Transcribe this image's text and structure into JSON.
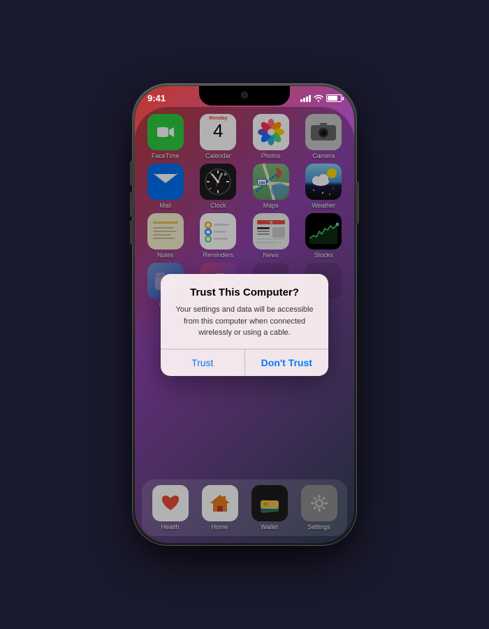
{
  "phone": {
    "time": "9:41",
    "notch": true
  },
  "apps": {
    "row1": [
      {
        "id": "facetime",
        "label": "FaceTime",
        "type": "facetime"
      },
      {
        "id": "calendar",
        "label": "Calendar",
        "type": "calendar",
        "day": "4",
        "dayName": "Monday"
      },
      {
        "id": "photos",
        "label": "Photos",
        "type": "photos"
      },
      {
        "id": "camera",
        "label": "Camera",
        "type": "camera"
      }
    ],
    "row2": [
      {
        "id": "mail",
        "label": "Mail",
        "type": "mail"
      },
      {
        "id": "clock",
        "label": "Clock",
        "type": "clock"
      },
      {
        "id": "maps",
        "label": "Maps",
        "type": "maps"
      },
      {
        "id": "weather",
        "label": "Weather",
        "type": "weather"
      }
    ],
    "row3": [
      {
        "id": "notes",
        "label": "Notes",
        "type": "notes"
      },
      {
        "id": "reminders",
        "label": "Reminders",
        "type": "reminders"
      },
      {
        "id": "news",
        "label": "News",
        "type": "news"
      },
      {
        "id": "stocks",
        "label": "Stocks",
        "type": "stocks"
      }
    ],
    "row4": [
      {
        "id": "files",
        "label": "Files",
        "type": "files"
      },
      {
        "id": "music",
        "label": "Music",
        "type": "music"
      },
      {
        "id": "empty1",
        "label": "",
        "type": "empty"
      },
      {
        "id": "empty2",
        "label": "",
        "type": "empty"
      }
    ],
    "dock": [
      {
        "id": "health",
        "label": "Health",
        "type": "health"
      },
      {
        "id": "home-app",
        "label": "Home",
        "type": "home-app"
      },
      {
        "id": "wallet",
        "label": "Wallet",
        "type": "wallet"
      },
      {
        "id": "settings",
        "label": "Settings",
        "type": "settings"
      }
    ]
  },
  "alert": {
    "title": "Trust This Computer?",
    "message": "Your settings and data will be accessible from this computer when connected wirelessly or using a cable.",
    "button_trust": "Trust",
    "button_dont_trust": "Don't Trust"
  }
}
